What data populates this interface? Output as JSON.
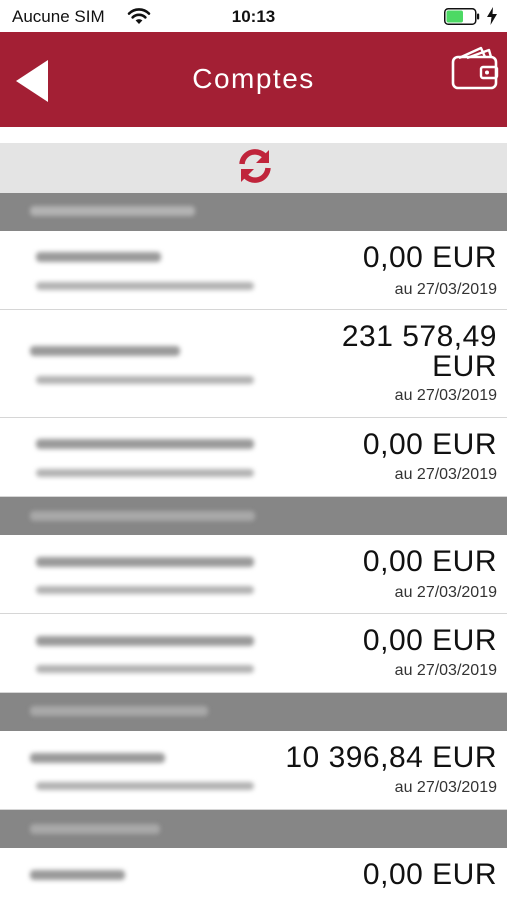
{
  "status_bar": {
    "carrier": "Aucune SIM",
    "time": "10:13",
    "battery_level": 0.6
  },
  "nav": {
    "title": "Comptes",
    "back_icon": "back-arrow-icon",
    "wallet_icon": "wallet-icon"
  },
  "refresh": {
    "icon": "refresh-icon",
    "color": "#c0243b"
  },
  "colors": {
    "brand": "#a31f34",
    "section_header": "#868686",
    "refresh_bar": "#e4e4e4",
    "battery_fill": "#4cd964"
  },
  "accounts": [
    {
      "amount": "0,00 EUR",
      "date": "au 27/03/2019"
    },
    {
      "amount": "231 578,49 EUR",
      "date": "au 27/03/2019"
    },
    {
      "amount": "0,00 EUR",
      "date": "au 27/03/2019"
    },
    {
      "amount": "0,00 EUR",
      "date": "au 27/03/2019"
    },
    {
      "amount": "0,00 EUR",
      "date": "au 27/03/2019"
    },
    {
      "amount": "10 396,84 EUR",
      "date": "au 27/03/2019"
    },
    {
      "amount": "0,00 EUR",
      "date": ""
    }
  ]
}
